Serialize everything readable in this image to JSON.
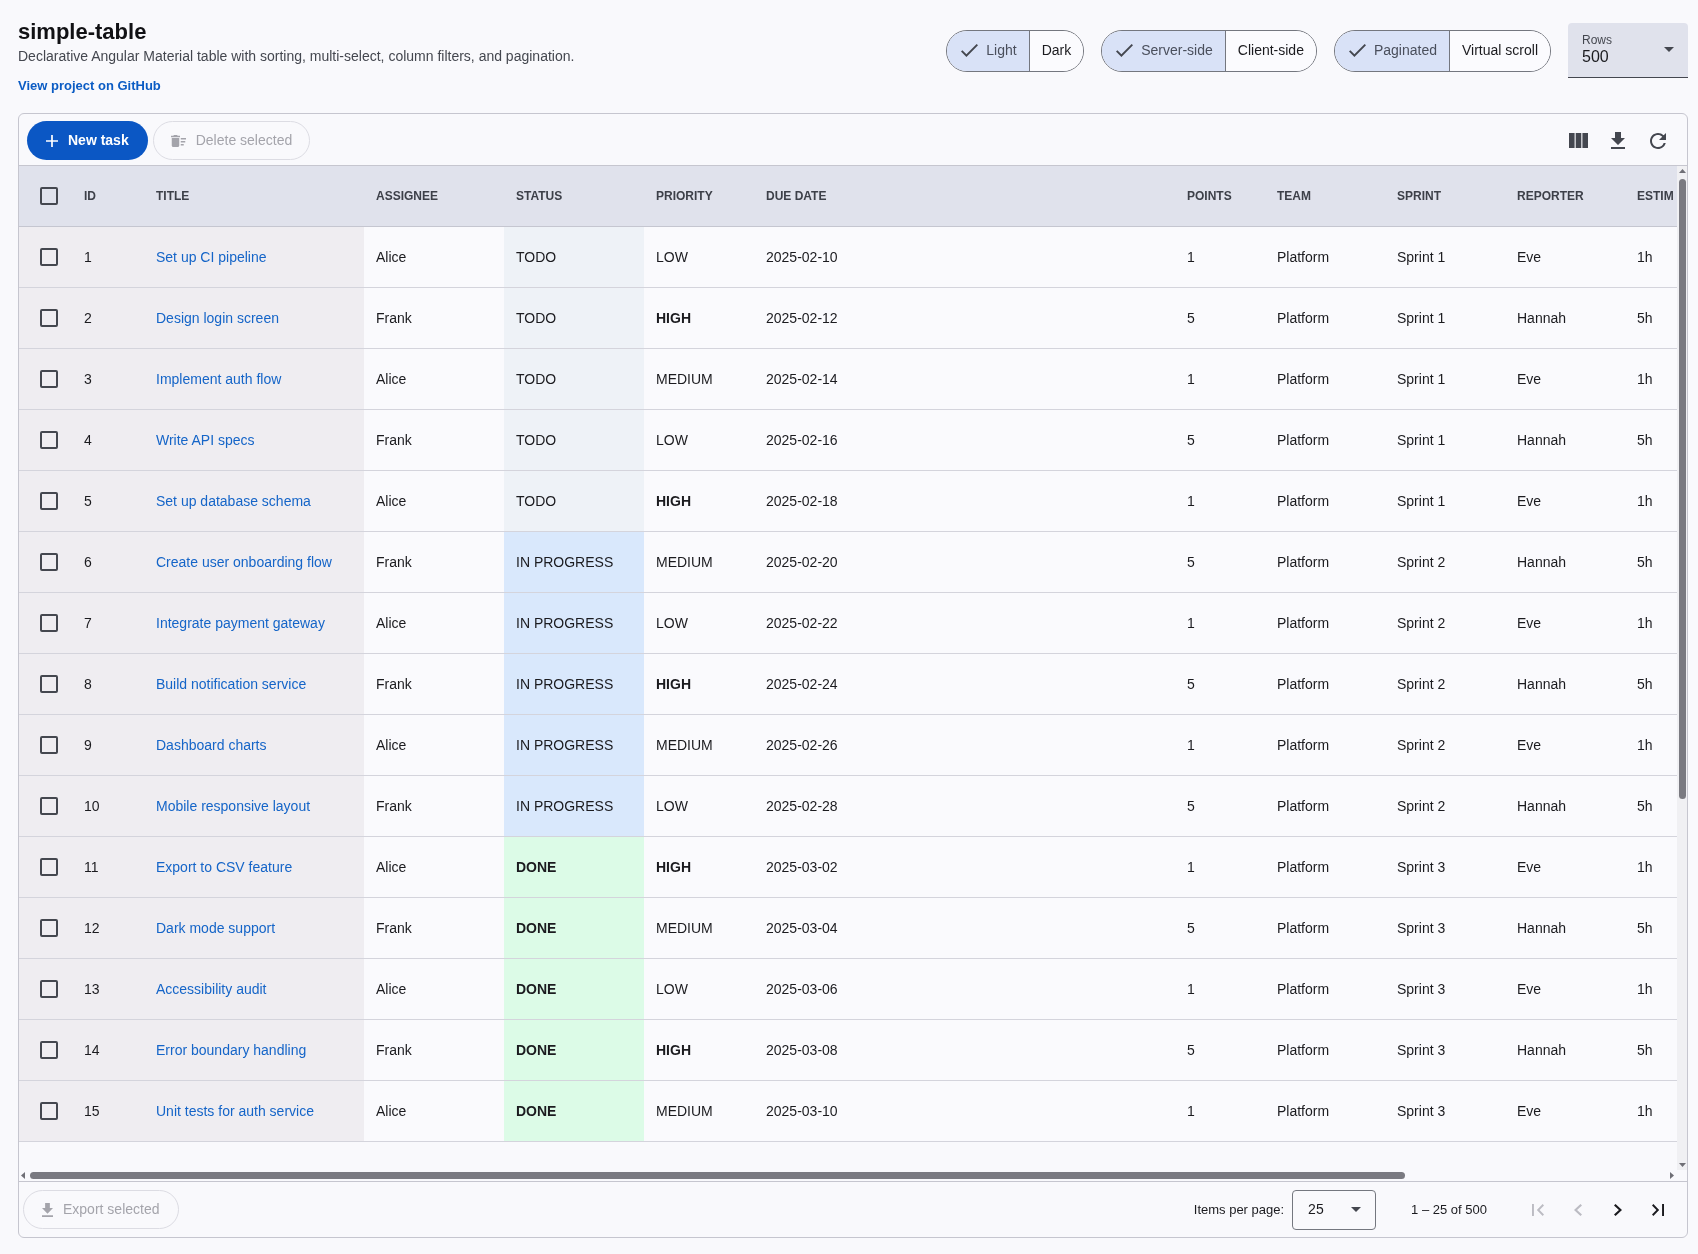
{
  "header": {
    "title": "simple-table",
    "description": "Declarative Angular Material table with sorting, multi-select, column filters, and pagination.",
    "link": "View project on GitHub"
  },
  "toggle_groups": [
    {
      "options": [
        {
          "label": "Light",
          "selected": true
        },
        {
          "label": "Dark",
          "selected": false
        }
      ]
    },
    {
      "options": [
        {
          "label": "Server-side",
          "selected": true
        },
        {
          "label": "Client-side",
          "selected": false
        }
      ]
    },
    {
      "options": [
        {
          "label": "Paginated",
          "selected": true
        },
        {
          "label": "Virtual scroll",
          "selected": false
        }
      ]
    }
  ],
  "rows_select": {
    "label": "Rows",
    "value": "500"
  },
  "toolbar": {
    "buttons": [
      {
        "kind": "add",
        "label": "New task",
        "disabled": false
      },
      {
        "kind": "delete",
        "label": "Delete selected",
        "disabled": true
      }
    ]
  },
  "table": {
    "select_all": {
      "checked": false
    },
    "columns": [
      {
        "label": "ID"
      },
      {
        "label": "TITLE"
      },
      {
        "label": "ASSIGNEE"
      },
      {
        "label": "STATUS"
      },
      {
        "label": "PRIORITY"
      },
      {
        "label": "DUE DATE"
      },
      {
        "label": "POINTS"
      },
      {
        "label": "TEAM"
      },
      {
        "label": "SPRINT"
      },
      {
        "label": "REPORTER"
      },
      {
        "label": "ESTIM"
      }
    ],
    "rows": [
      {
        "checked": false,
        "id": "1",
        "title": "Set up CI pipeline",
        "assignee": "Alice",
        "status": {
          "label": "TODO",
          "kind": "todo"
        },
        "priority": {
          "label": "LOW",
          "kind": "low"
        },
        "due_date": "2025-02-10",
        "points": "1",
        "team": "Platform",
        "sprint": "Sprint 1",
        "reporter": "Eve",
        "column_11": "1h"
      },
      {
        "checked": false,
        "id": "2",
        "title": "Design login screen",
        "assignee": "Frank",
        "status": {
          "label": "TODO",
          "kind": "todo"
        },
        "priority": {
          "label": "HIGH",
          "kind": "high"
        },
        "due_date": "2025-02-12",
        "points": "5",
        "team": "Platform",
        "sprint": "Sprint 1",
        "reporter": "Hannah",
        "column_11": "5h"
      },
      {
        "checked": false,
        "id": "3",
        "title": "Implement auth flow",
        "assignee": "Alice",
        "status": {
          "label": "TODO",
          "kind": "todo"
        },
        "priority": {
          "label": "MEDIUM",
          "kind": "medium"
        },
        "due_date": "2025-02-14",
        "points": "1",
        "team": "Platform",
        "sprint": "Sprint 1",
        "reporter": "Eve",
        "column_11": "1h"
      },
      {
        "checked": false,
        "id": "4",
        "title": "Write API specs",
        "assignee": "Frank",
        "status": {
          "label": "TODO",
          "kind": "todo"
        },
        "priority": {
          "label": "LOW",
          "kind": "low"
        },
        "due_date": "2025-02-16",
        "points": "5",
        "team": "Platform",
        "sprint": "Sprint 1",
        "reporter": "Hannah",
        "column_11": "5h"
      },
      {
        "checked": false,
        "id": "5",
        "title": "Set up database schema",
        "assignee": "Alice",
        "status": {
          "label": "TODO",
          "kind": "todo"
        },
        "priority": {
          "label": "HIGH",
          "kind": "high"
        },
        "due_date": "2025-02-18",
        "points": "1",
        "team": "Platform",
        "sprint": "Sprint 1",
        "reporter": "Eve",
        "column_11": "1h"
      },
      {
        "checked": false,
        "id": "6",
        "title": "Create user onboarding flow",
        "assignee": "Frank",
        "status": {
          "label": "IN PROGRESS",
          "kind": "in_progress"
        },
        "priority": {
          "label": "MEDIUM",
          "kind": "medium"
        },
        "due_date": "2025-02-20",
        "points": "5",
        "team": "Platform",
        "sprint": "Sprint 2",
        "reporter": "Hannah",
        "column_11": "5h"
      },
      {
        "checked": false,
        "id": "7",
        "title": "Integrate payment gateway",
        "assignee": "Alice",
        "status": {
          "label": "IN PROGRESS",
          "kind": "in_progress"
        },
        "priority": {
          "label": "LOW",
          "kind": "low"
        },
        "due_date": "2025-02-22",
        "points": "1",
        "team": "Platform",
        "sprint": "Sprint 2",
        "reporter": "Eve",
        "column_11": "1h"
      },
      {
        "checked": false,
        "id": "8",
        "title": "Build notification service",
        "assignee": "Frank",
        "status": {
          "label": "IN PROGRESS",
          "kind": "in_progress"
        },
        "priority": {
          "label": "HIGH",
          "kind": "high"
        },
        "due_date": "2025-02-24",
        "points": "5",
        "team": "Platform",
        "sprint": "Sprint 2",
        "reporter": "Hannah",
        "column_11": "5h"
      },
      {
        "checked": false,
        "id": "9",
        "title": "Dashboard charts",
        "assignee": "Alice",
        "status": {
          "label": "IN PROGRESS",
          "kind": "in_progress"
        },
        "priority": {
          "label": "MEDIUM",
          "kind": "medium"
        },
        "due_date": "2025-02-26",
        "points": "1",
        "team": "Platform",
        "sprint": "Sprint 2",
        "reporter": "Eve",
        "column_11": "1h"
      },
      {
        "checked": false,
        "id": "10",
        "title": "Mobile responsive layout",
        "assignee": "Frank",
        "status": {
          "label": "IN PROGRESS",
          "kind": "in_progress"
        },
        "priority": {
          "label": "LOW",
          "kind": "low"
        },
        "due_date": "2025-02-28",
        "points": "5",
        "team": "Platform",
        "sprint": "Sprint 2",
        "reporter": "Hannah",
        "column_11": "5h"
      },
      {
        "checked": false,
        "id": "11",
        "title": "Export to CSV feature",
        "assignee": "Alice",
        "status": {
          "label": "DONE",
          "kind": "done"
        },
        "priority": {
          "label": "HIGH",
          "kind": "high"
        },
        "due_date": "2025-03-02",
        "points": "1",
        "team": "Platform",
        "sprint": "Sprint 3",
        "reporter": "Eve",
        "column_11": "1h"
      },
      {
        "checked": false,
        "id": "12",
        "title": "Dark mode support",
        "assignee": "Frank",
        "status": {
          "label": "DONE",
          "kind": "done"
        },
        "priority": {
          "label": "MEDIUM",
          "kind": "medium"
        },
        "due_date": "2025-03-04",
        "points": "5",
        "team": "Platform",
        "sprint": "Sprint 3",
        "reporter": "Hannah",
        "column_11": "5h"
      },
      {
        "checked": false,
        "id": "13",
        "title": "Accessibility audit",
        "assignee": "Alice",
        "status": {
          "label": "DONE",
          "kind": "done"
        },
        "priority": {
          "label": "LOW",
          "kind": "low"
        },
        "due_date": "2025-03-06",
        "points": "1",
        "team": "Platform",
        "sprint": "Sprint 3",
        "reporter": "Eve",
        "column_11": "1h"
      },
      {
        "checked": false,
        "id": "14",
        "title": "Error boundary handling",
        "assignee": "Frank",
        "status": {
          "label": "DONE",
          "kind": "done"
        },
        "priority": {
          "label": "HIGH",
          "kind": "high"
        },
        "due_date": "2025-03-08",
        "points": "5",
        "team": "Platform",
        "sprint": "Sprint 3",
        "reporter": "Hannah",
        "column_11": "5h"
      },
      {
        "checked": false,
        "id": "15",
        "title": "Unit tests for auth service",
        "assignee": "Alice",
        "status": {
          "label": "DONE",
          "kind": "done"
        },
        "priority": {
          "label": "MEDIUM",
          "kind": "medium"
        },
        "due_date": "2025-03-10",
        "points": "1",
        "team": "Platform",
        "sprint": "Sprint 3",
        "reporter": "Eve",
        "column_11": "1h"
      }
    ]
  },
  "footer": {
    "export_button": {
      "label": "Export selected",
      "disabled": true
    },
    "items_per_page": {
      "label": "Items per page:",
      "value": "25"
    },
    "range": "1 – 25 of 500",
    "nav": [
      {
        "kind": "first",
        "disabled": true
      },
      {
        "kind": "previous",
        "disabled": true
      },
      {
        "kind": "next",
        "disabled": false
      },
      {
        "kind": "last",
        "disabled": false
      }
    ]
  }
}
